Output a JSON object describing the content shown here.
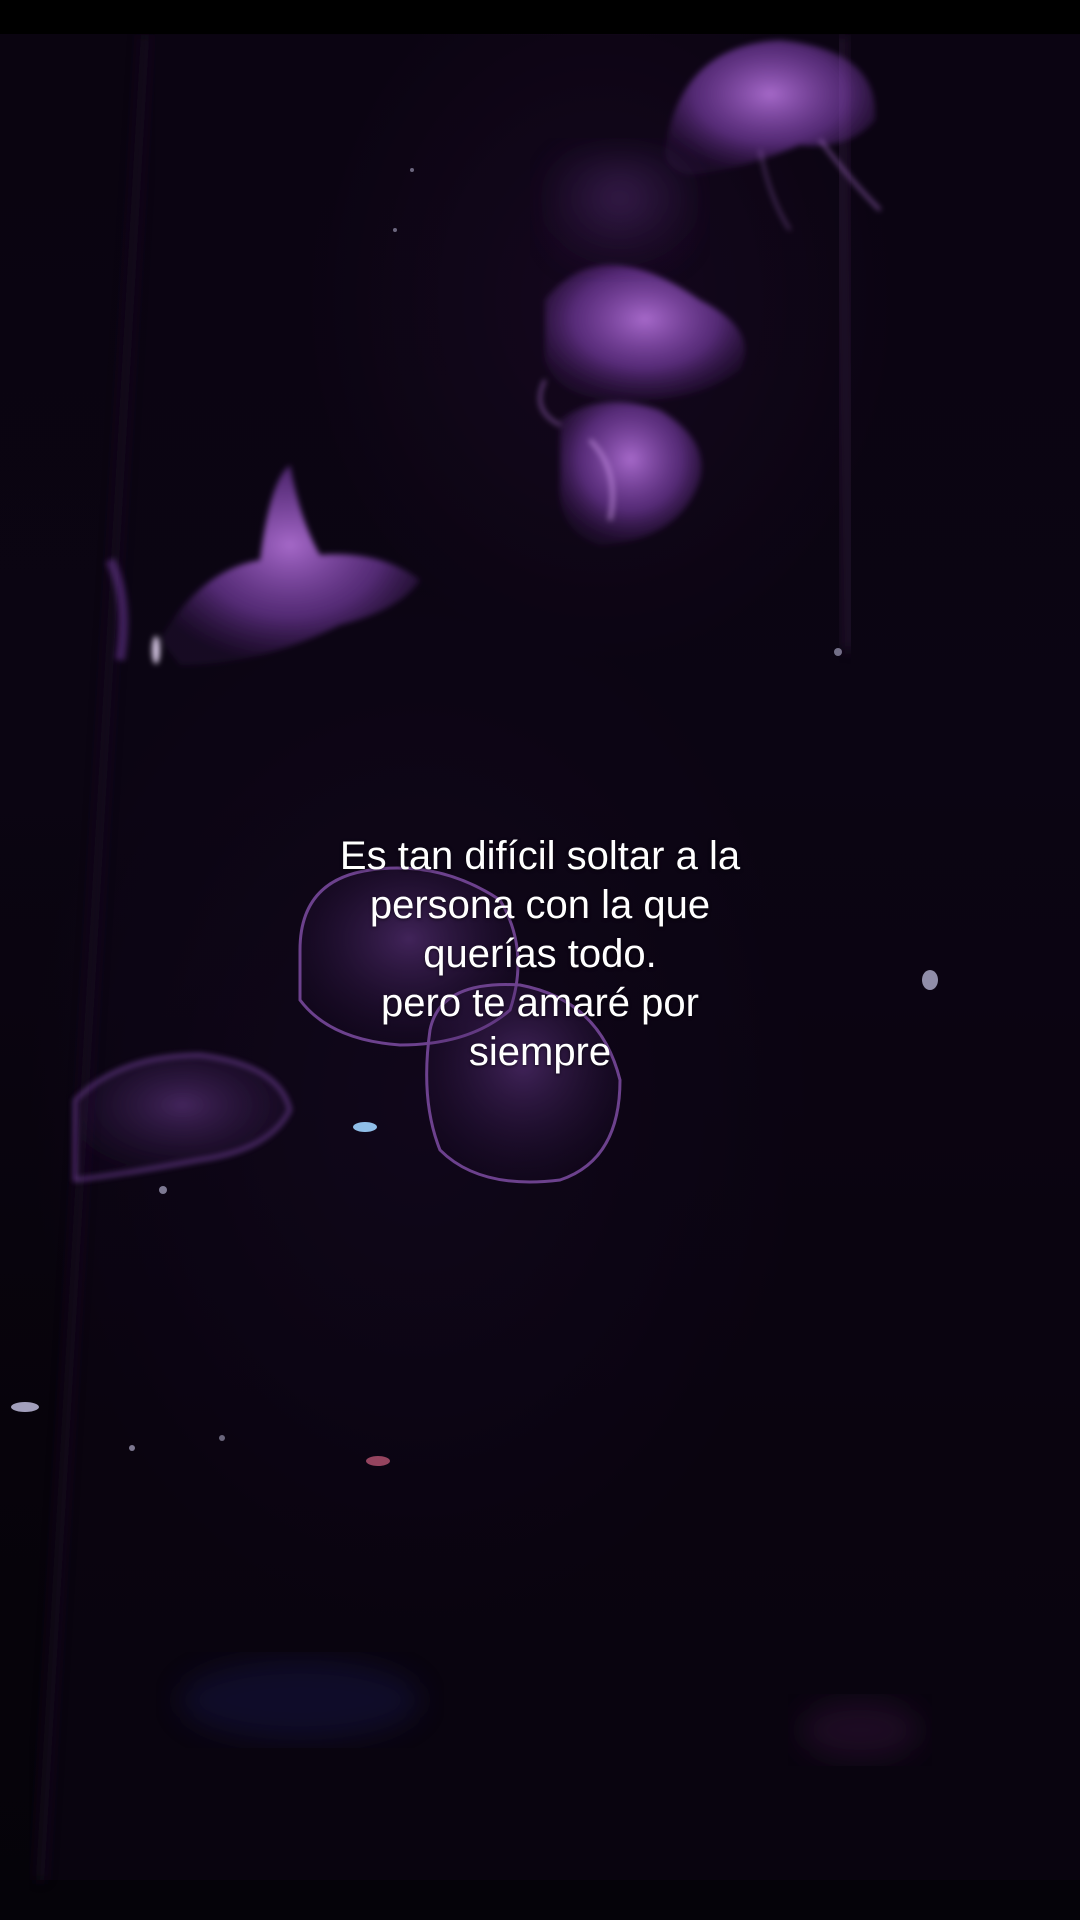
{
  "caption": {
    "text": "Es tan difícil soltar a la\npersona con la que\nquerías todo.\npero te amaré por\nsiempre"
  },
  "scene": {
    "subject": "jellyfish-icon",
    "background_color": "#07030b",
    "accent_color": "#a765d6"
  }
}
